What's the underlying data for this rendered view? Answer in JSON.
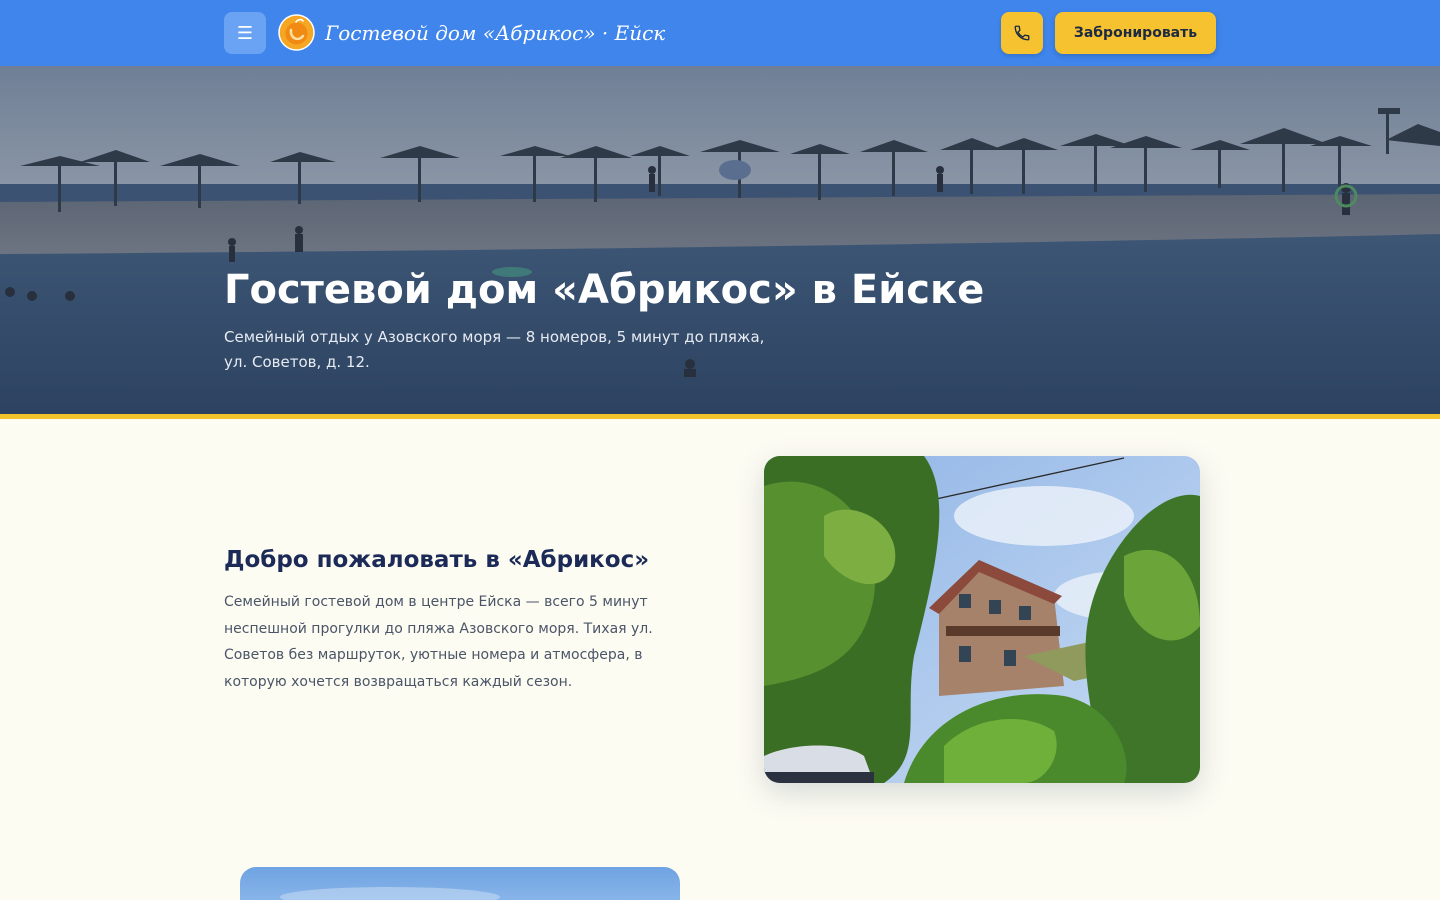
{
  "header": {
    "menu_icon": "☰",
    "brand": "Гостевой дом «Абрикос» · Ейск",
    "book_label": "Забронировать",
    "colors": {
      "bar": "#3f85ec",
      "accent": "#f7c22f"
    }
  },
  "hero": {
    "title": "Гостевой дом «Абрикос» в Ейске",
    "subtitle": "Семейный отдых у Азовского моря — 8 номеров, 5 минут до пляжа, ул. Советов, д. 12."
  },
  "welcome": {
    "title": "Добро пожаловать в «Абрикос»",
    "text": "Семейный гостевой дом в центре Ейска — всего 5 минут неспешной прогулки до пляжа Азовского моря. Тихая ул. Советов без маршруток, уютные номера и атмосфера, в которую хочется возвращаться каждый сезон."
  }
}
